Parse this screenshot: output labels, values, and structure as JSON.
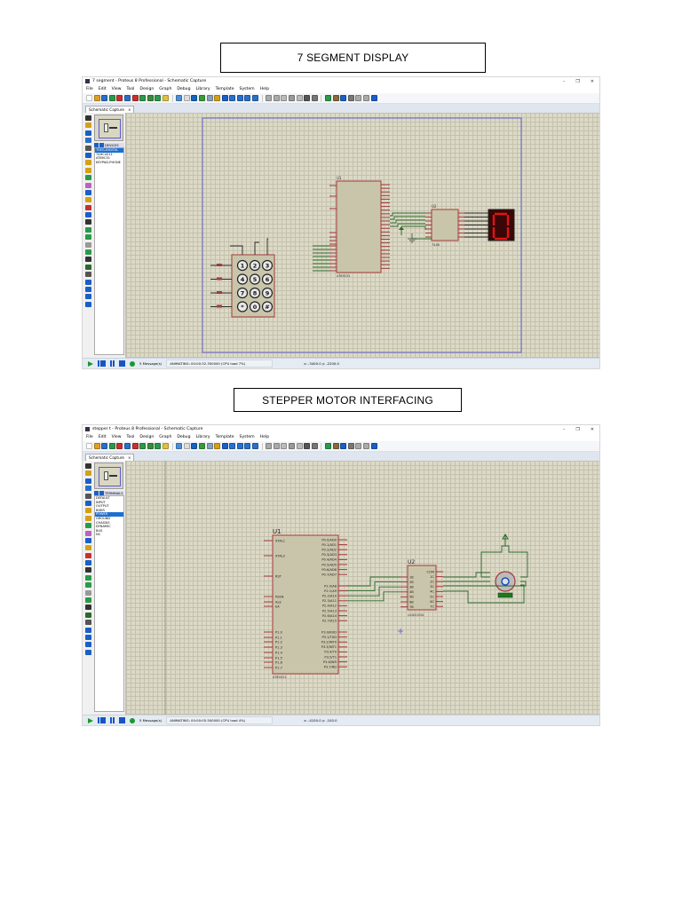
{
  "captions": [
    "7 SEGMENT DISPLAY",
    "STEPPER MOTOR INTERFACING"
  ],
  "common": {
    "menu": [
      "File",
      "Edit",
      "View",
      "Tool",
      "Design",
      "Graph",
      "Debug",
      "Library",
      "Template",
      "System",
      "Help"
    ],
    "tab_label": "Schematic Capture",
    "tab_close": "×",
    "window_controls": [
      "–",
      "❐",
      "✕"
    ],
    "toolbar_colors": [
      "#ffffff",
      "#e0a020",
      "#2a6fc9",
      "#2a9a4a",
      "#c83030",
      "#2a6fc9",
      "#c83030",
      "#2a9a4a",
      "#3a8a3a",
      "#2a9a4a",
      "#e0c040",
      "#4a90d9",
      "#dddddd",
      "#1565c0",
      "#3a9a3a",
      "#8aa0c0",
      "#d4a017",
      "#1a5fc7",
      "#2a6fc9",
      "#2a6fc9",
      "#2a6fc9",
      "#2a6fc9",
      "#aaaaaa",
      "#aaaaaa",
      "#bbbbbb",
      "#999999",
      "#bbbbbb",
      "#555555",
      "#777777",
      "#2a9a4a",
      "#8a6a3a",
      "#1a5fc7",
      "#777777",
      "#aaaaaa",
      "#aaaaaa",
      "#1a5fc7"
    ],
    "strip_colors": [
      "#333",
      "#d4a017",
      "#1a5fc7",
      "#2a6fc9",
      "#555",
      "#1a5fc7",
      "#d4a017",
      "#d4a017",
      "#2a9a4a",
      "#c060c0",
      "#1a5fc7",
      "#d4a017",
      "#c83030",
      "#1a5fc7",
      "#333",
      "#2a9a4a",
      "#2a9a4a",
      "#999",
      "#2a9a4a",
      "#333",
      "#2a6a2a",
      "#555",
      "#1a5fc7",
      "#1a5fc7",
      "#1a5fc7",
      "#1a5fc7"
    ]
  },
  "windows": [
    {
      "title": "7 segment - Proteus 8 Professional - Schematic Capture",
      "panel_header": "DEVICES",
      "panel_items": [
        "7SEG-DIGITAL",
        "74HC4511",
        "AT89C51",
        "KEYPAD-PHONE"
      ],
      "selected_index": 0,
      "status": {
        "messages": "5 Message(s)",
        "animating": "ANIMATING: 00:00:32.350000 (CPU load 7%)",
        "coords": "x:  -3400.0  y:  -2200.0"
      },
      "schematic": {
        "u1_ref": "U1",
        "u1_part": "AT89C51",
        "u2_ref": "U2",
        "u2_part": "7448",
        "keypad_keys": [
          "1",
          "2",
          "3",
          "4",
          "5",
          "6",
          "7",
          "8",
          "9",
          "*",
          "0",
          "#"
        ],
        "display_digit": "0"
      }
    },
    {
      "title": "stepper t - Proteus 8 Professional - Schematic Capture",
      "panel_header": "TERMINALS",
      "panel_items": [
        "DEFAULT",
        "INPUT",
        "OUTPUT",
        "BIDIR",
        "POWER",
        "GROUND",
        "CHASSIS",
        "DYNAMIC",
        "BUS",
        "NC"
      ],
      "selected_index": 4,
      "status": {
        "messages": "5 Message(s)",
        "animating": "ANIMATING: 00:00:05.500000 (CPU load 4%)",
        "coords": "x:  -4100.0  y:  -100.0"
      },
      "schematic": {
        "u1_ref": "U1",
        "u1_part": "AT89C51",
        "u2_ref": "U2",
        "u2_part": "ULN2003A",
        "u1_left": [
          "XTAL1",
          "XTAL2",
          "RST",
          "PSEN",
          "ALE",
          "EA",
          "P1.0",
          "P1.1",
          "P1.2",
          "P1.3",
          "P1.4",
          "P1.5",
          "P1.6",
          "P1.7"
        ],
        "u1_right": [
          "P0.0/AD0",
          "P0.1/AD1",
          "P0.2/AD2",
          "P0.3/AD3",
          "P0.4/AD4",
          "P0.5/AD5",
          "P0.6/AD6",
          "P0.7/AD7",
          "P2.0/A8",
          "P2.1/A9",
          "P2.2/A10",
          "P2.3/A11",
          "P2.4/A12",
          "P2.5/A13",
          "P2.6/A14",
          "P2.7/A15",
          "P3.0/RXD",
          "P3.1/TXD",
          "P3.2/INT0",
          "P3.3/INT1",
          "P3.4/T0",
          "P3.5/T1",
          "P3.6/WR",
          "P3.7/RD"
        ],
        "u2_left": [
          "1B",
          "2B",
          "3B",
          "4B",
          "5B",
          "6B",
          "7B"
        ],
        "u2_right": [
          "COM",
          "1C",
          "2C",
          "3C",
          "4C",
          "5C",
          "6C",
          "7C"
        ]
      }
    }
  ]
}
